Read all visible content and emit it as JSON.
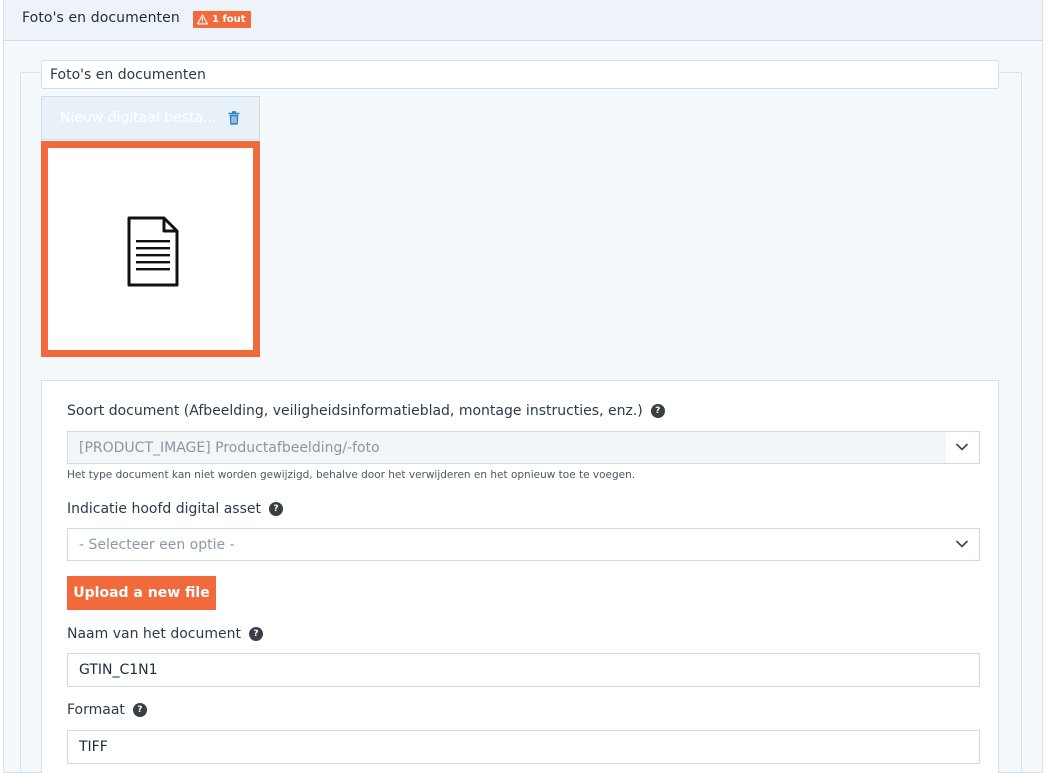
{
  "header": {
    "title": "Foto's en documenten",
    "error_badge": "1 fout"
  },
  "group": {
    "legend": "Foto's en documenten"
  },
  "file_card": {
    "name": "Nieuw digitaal besta...",
    "icon": "document-icon",
    "border_color": "#f06a3c"
  },
  "form": {
    "document_type": {
      "label": "Soort document (Afbeelding, veiligheidsinformatieblad, montage instructies, enz.)",
      "value": "[PRODUCT_IMAGE] Productafbeelding/-foto",
      "hint": "Het type document kan niet worden gewijzigd, behalve door het verwijderen en het opnieuw toe te voegen."
    },
    "main_asset": {
      "label": "Indicatie hoofd digital asset",
      "placeholder": "- Selecteer een optie -"
    },
    "upload_button": "Upload a new file",
    "document_name": {
      "label": "Naam van het document",
      "value": "GTIN_C1N1"
    },
    "format": {
      "label": "Formaat",
      "value": "TIFF"
    }
  },
  "colors": {
    "accent": "#f06a3c",
    "panel_bg": "#f6f9fc",
    "header_bg": "#edf3f9"
  }
}
